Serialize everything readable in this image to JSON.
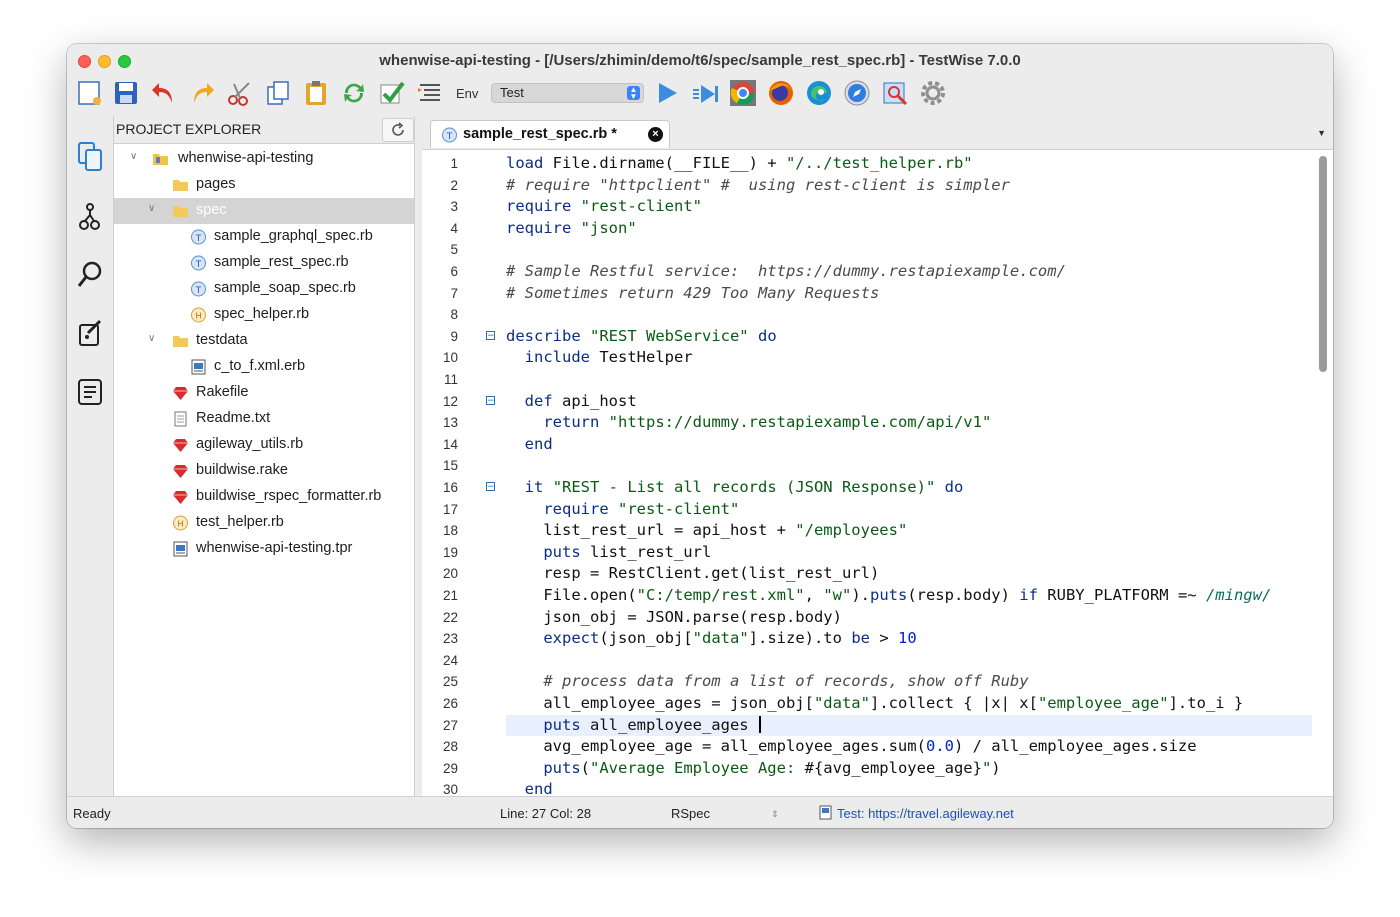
{
  "window": {
    "title": "whenwise-api-testing - [/Users/zhimin/demo/t6/spec/sample_rest_spec.rb] - TestWise 7.0.0"
  },
  "toolbar": {
    "env_label": "Env",
    "env_value": "Test"
  },
  "explorer": {
    "title": "PROJECT EXPLORER",
    "items": [
      {
        "label": "whenwise-api-testing",
        "icon": "project-folder-icon"
      },
      {
        "label": "pages",
        "icon": "folder-icon"
      },
      {
        "label": "spec",
        "icon": "folder-icon"
      },
      {
        "label": "sample_graphql_spec.rb",
        "icon": "test-file-icon"
      },
      {
        "label": "sample_rest_spec.rb",
        "icon": "test-file-icon"
      },
      {
        "label": "sample_soap_spec.rb",
        "icon": "test-file-icon"
      },
      {
        "label": "spec_helper.rb",
        "icon": "helper-file-icon"
      },
      {
        "label": "testdata",
        "icon": "folder-icon"
      },
      {
        "label": "c_to_f.xml.erb",
        "icon": "xml-file-icon"
      },
      {
        "label": "Rakefile",
        "icon": "ruby-gem-icon"
      },
      {
        "label": "Readme.txt",
        "icon": "text-file-icon"
      },
      {
        "label": "agileway_utils.rb",
        "icon": "ruby-gem-icon"
      },
      {
        "label": "buildwise.rake",
        "icon": "ruby-gem-icon"
      },
      {
        "label": "buildwise_rspec_formatter.rb",
        "icon": "ruby-gem-icon"
      },
      {
        "label": "test_helper.rb",
        "icon": "helper-file-icon"
      },
      {
        "label": "whenwise-api-testing.tpr",
        "icon": "project-file-icon"
      }
    ]
  },
  "editor": {
    "tab_label": "sample_rest_spec.rb *",
    "lines": [
      "load File.dirname(__FILE__) + \"/../test_helper.rb\"",
      "# require \"httpclient\" #  using rest-client is simpler",
      "require \"rest-client\"",
      "require \"json\"",
      "",
      "# Sample Restful service:  https://dummy.restapiexample.com/",
      "# Sometimes return 429 Too Many Requests",
      "",
      "describe \"REST WebService\" do",
      "  include TestHelper",
      "",
      "  def api_host",
      "    return \"https://dummy.restapiexample.com/api/v1\"",
      "  end",
      "",
      "  it \"REST - List all records (JSON Response)\" do",
      "    require \"rest-client\"",
      "    list_rest_url = api_host + \"/employees\"",
      "    puts list_rest_url",
      "    resp = RestClient.get(list_rest_url)",
      "    File.open(\"C:/temp/rest.xml\", \"w\").puts(resp.body) if RUBY_PLATFORM =~ /mingw/",
      "    json_obj = JSON.parse(resp.body)",
      "    expect(json_obj[\"data\"].size).to be > 10",
      "",
      "    # process data from a list of records, show off Ruby",
      "    all_employee_ages = json_obj[\"data\"].collect { |x| x[\"employee_age\"].to_i }",
      "    puts all_employee_ages ",
      "    avg_employee_age = all_employee_ages.sum(0.0) / all_employee_ages.size",
      "    puts(\"Average Employee Age: #{avg_employee_age}\")",
      "  end"
    ]
  },
  "status": {
    "ready": "Ready",
    "line_col": "Line: 27  Col: 28",
    "mode": "RSpec",
    "test_link": "Test: https://travel.agileway.net"
  }
}
